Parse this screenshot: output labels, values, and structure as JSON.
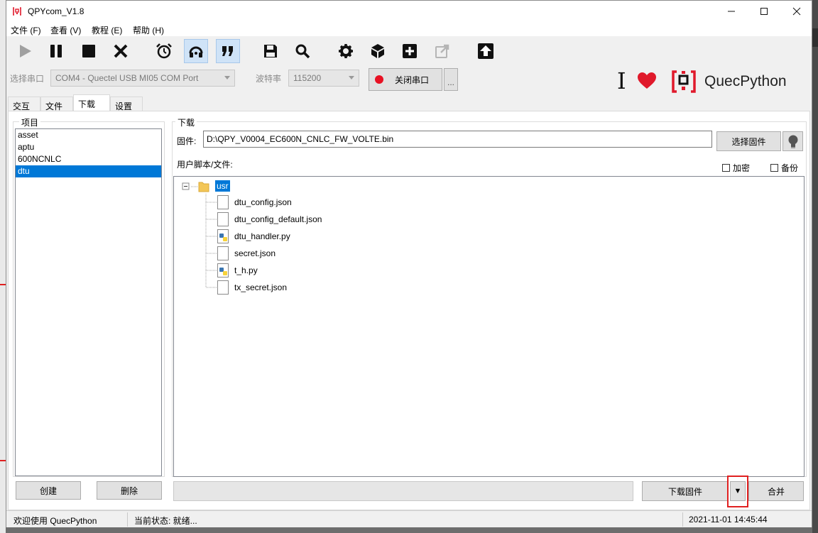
{
  "window": {
    "title": "QPYcom_V1.8"
  },
  "menu": {
    "items": [
      "文件 (F)",
      "查看 (V)",
      "教程 (E)",
      "帮助 (H)"
    ]
  },
  "toolbar": {
    "buttons": [
      "play-icon",
      "pause-icon",
      "stop-icon",
      "close-x-icon",
      "alarm-clock-icon",
      "headset-icon",
      "quote-icon",
      "save-icon",
      "search-icon",
      "settings-gear-icon",
      "cube-icon",
      "add-plus-icon",
      "external-link-icon",
      "upload-arrow-icon"
    ]
  },
  "port": {
    "label": "选择串口",
    "value": "COM4 - Quectel USB MI05 COM Port",
    "baud_label": "波特率",
    "baud_value": "115200",
    "toggle_label": "关闭串口",
    "more_label": "..."
  },
  "brand": {
    "i_text": "I",
    "name": "QuecPython"
  },
  "tabs": [
    {
      "label": "交互"
    },
    {
      "label": "文件"
    },
    {
      "label": "下载",
      "selected": true
    },
    {
      "label": "设置"
    }
  ],
  "project": {
    "title": "项目",
    "items": [
      "asset",
      "aptu",
      "600NCNLC",
      "dtu"
    ],
    "selected_index": 3,
    "create_label": "创建",
    "delete_label": "删除"
  },
  "download": {
    "title": "下载",
    "firmware_label": "固件:",
    "firmware_path": "D:\\QPY_V0004_EC600N_CNLC_FW_VOLTE.bin",
    "choose_firmware_label": "选择固件",
    "scripts_label": "用户脚本/文件:",
    "encrypt_label": "加密",
    "backup_label": "备份",
    "tree": {
      "root": "usr",
      "files": [
        {
          "name": "dtu_config.json",
          "type": "file"
        },
        {
          "name": "dtu_config_default.json",
          "type": "file"
        },
        {
          "name": "dtu_handler.py",
          "type": "python"
        },
        {
          "name": "secret.json",
          "type": "file"
        },
        {
          "name": "t_h.py",
          "type": "python"
        },
        {
          "name": "tx_secret.json",
          "type": "file"
        }
      ]
    },
    "download_firmware_label": "下载固件",
    "dropdown_label": "▼",
    "merge_label": "合并"
  },
  "status": {
    "welcome": "欢迎使用 QuecPython",
    "state": "当前状态: 就绪...",
    "datetime": "2021-11-01 14:45:44"
  },
  "colors": {
    "accent": "#0078d7",
    "brand_red": "#e0192b",
    "highlight": "#e02020"
  }
}
